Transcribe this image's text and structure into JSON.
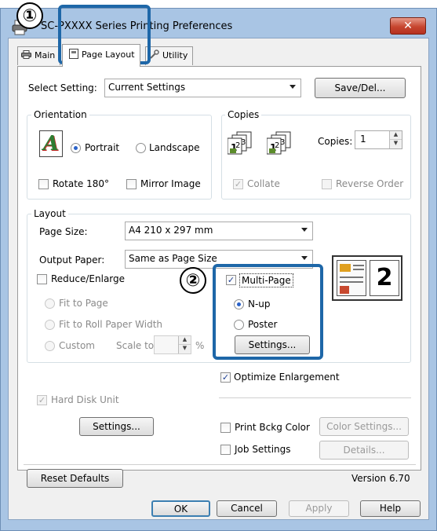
{
  "window": {
    "title": "SC-PXXXX Series Printing Preferences",
    "close_glyph": "✕"
  },
  "tabs": [
    {
      "label": "Main",
      "active": false
    },
    {
      "label": "Page Layout",
      "active": true
    },
    {
      "label": "Utility",
      "active": false
    }
  ],
  "select_setting": {
    "label": "Select Setting:",
    "value": "Current Settings",
    "save_button": "Save/Del..."
  },
  "orientation": {
    "group_label": "Orientation",
    "portrait": "Portrait",
    "landscape": "Landscape",
    "selected": "portrait",
    "rotate": "Rotate 180°",
    "mirror": "Mirror Image",
    "icon_letter": "A"
  },
  "copies": {
    "group_label": "Copies",
    "copies_label": "Copies:",
    "copies_value": "1",
    "collate": "Collate",
    "collate_checked": true,
    "reverse": "Reverse Order",
    "reverse_checked": false
  },
  "layout": {
    "group_label": "Layout",
    "page_size_label": "Page Size:",
    "page_size_value": "A4 210 x 297 mm",
    "output_paper_label": "Output Paper:",
    "output_paper_value": "Same as Page Size",
    "reduce_enlarge": "Reduce/Enlarge",
    "fit_to_page": "Fit to Page",
    "fit_to_roll": "Fit to Roll Paper Width",
    "custom": "Custom",
    "scale_to": "Scale to",
    "percent": "%",
    "multi_page": "Multi-Page",
    "multi_page_checked": true,
    "n_up": "N-up",
    "poster": "Poster",
    "multi_page_mode": "n_up",
    "settings_button": "Settings...",
    "preview_number": "2"
  },
  "optimize": {
    "label": "Optimize Enlargement",
    "checked": true
  },
  "hard_disk": {
    "label": "Hard Disk Unit",
    "settings_button": "Settings..."
  },
  "print_bckg": {
    "label": "Print Bckg Color",
    "button": "Color Settings..."
  },
  "job_settings": {
    "label": "Job Settings",
    "button": "Details..."
  },
  "footer": {
    "reset_button": "Reset Defaults",
    "version": "Version 6.70"
  },
  "dialog_buttons": {
    "ok": "OK",
    "cancel": "Cancel",
    "apply": "Apply",
    "help": "Help"
  },
  "callouts": {
    "one": "①",
    "two": "②"
  },
  "colors": {
    "callout_blue": "#1e67a8",
    "frame": "#a9c5e4",
    "close_red": "#c7462f"
  }
}
